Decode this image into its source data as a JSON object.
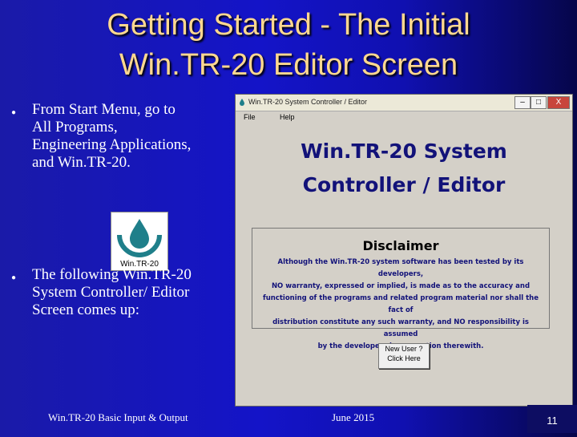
{
  "slide": {
    "title_line1": "Getting Started - The Initial",
    "title_line2": "Win.TR-20 Editor Screen",
    "bullets": [
      "From Start Menu, go to\nAll Programs,\nEngineering Applications,\nand Win.TR-20.",
      "The following Win.TR-20\nSystem Controller/ Editor\nScreen comes up:"
    ],
    "logo_label": "Win.TR-20",
    "footer_left": "Win.TR-20 Basic Input & Output",
    "footer_date": "June 2015",
    "page_number": "11"
  },
  "window": {
    "title": "Win.TR-20 System Controller / Editor",
    "minimize_label": "–",
    "maximize_label": "□",
    "close_label": "X",
    "menu": [
      "File",
      "Help"
    ],
    "app_title_line1": "Win.TR-20 System",
    "app_title_line2": "Controller / Editor",
    "disclaimer_heading": "Disclaimer",
    "disclaimer_lines": [
      "Although the Win.TR-20 system software has been tested by its developers,",
      "NO warranty, expressed or implied, is made as to the accuracy and",
      "functioning of the programs and related program material nor shall the fact of",
      "distribution constitute any such warranty, and NO responsibility is assumed",
      "by the developers in connection therewith."
    ],
    "new_user_line1": "New User ?",
    "new_user_line2": "Click Here"
  },
  "colors": {
    "title": "#ffd890",
    "app_title": "#121279",
    "background": "#1414c8"
  }
}
